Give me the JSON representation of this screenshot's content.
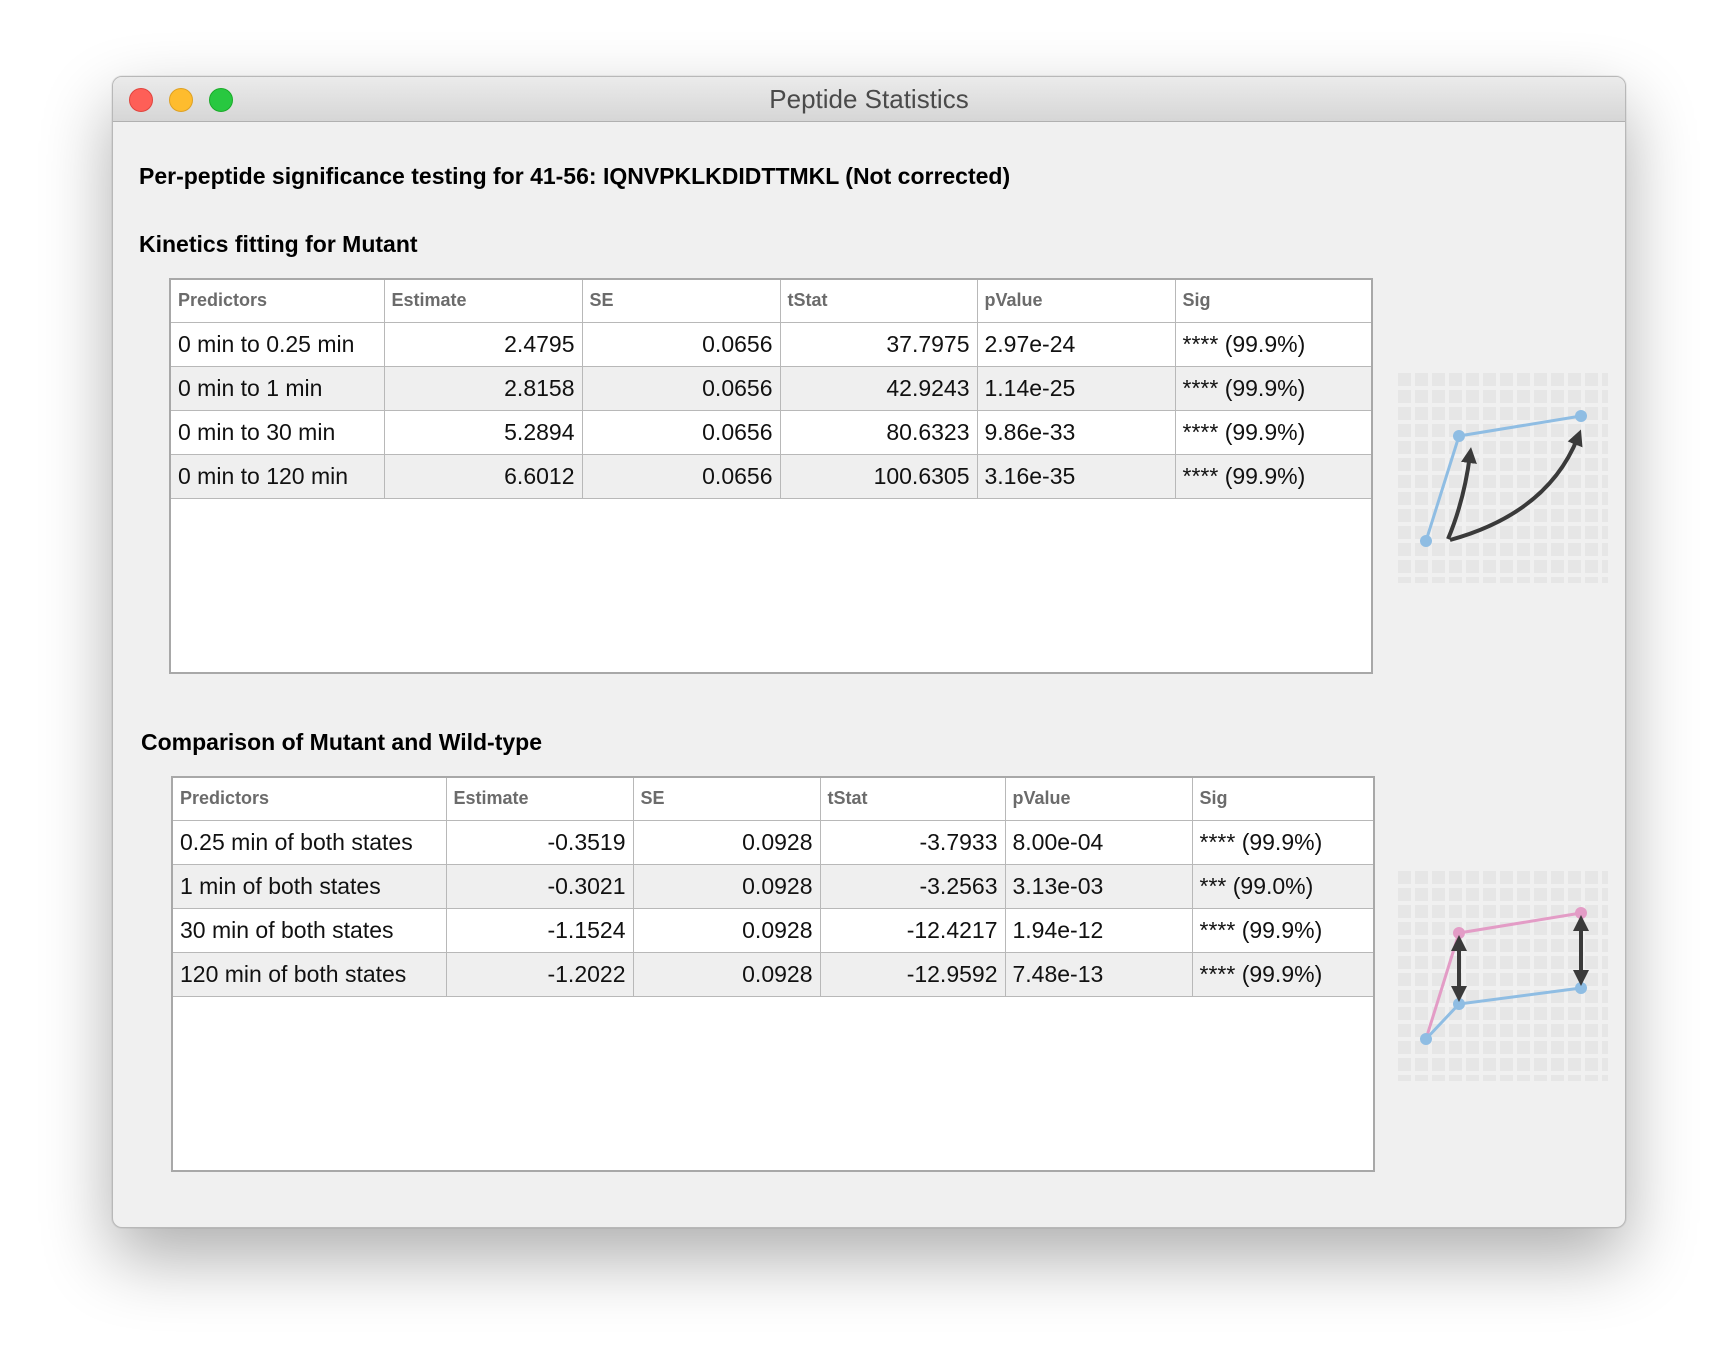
{
  "window": {
    "title": "Peptide Statistics"
  },
  "page_heading": "Per-peptide significance testing for 41-56: IQNVPKLKDIDTTMKL (Not corrected)",
  "kinetics": {
    "heading": "Kinetics fitting for Mutant",
    "columns": [
      "Predictors",
      "Estimate",
      "SE",
      "tStat",
      "pValue",
      "Sig"
    ],
    "rows": [
      [
        "0 min to 0.25 min",
        "2.4795",
        "0.0656",
        "37.7975",
        "2.97e-24",
        "**** (99.9%)"
      ],
      [
        "0 min to 1 min",
        "2.8158",
        "0.0656",
        "42.9243",
        "1.14e-25",
        "**** (99.9%)"
      ],
      [
        "0 min to 30 min",
        "5.2894",
        "0.0656",
        "80.6323",
        "9.86e-33",
        "**** (99.9%)"
      ],
      [
        "0 min to 120 min",
        "6.6012",
        "0.0656",
        "100.6305",
        "3.16e-35",
        "**** (99.9%)"
      ]
    ]
  },
  "comparison": {
    "heading": "Comparison of Mutant and Wild-type",
    "columns": [
      "Predictors",
      "Estimate",
      "SE",
      "tStat",
      "pValue",
      "Sig"
    ],
    "rows": [
      [
        "0.25 min of both states",
        "-0.3519",
        "0.0928",
        "-3.7933",
        "8.00e-04",
        "**** (99.9%)"
      ],
      [
        "1 min of both states",
        "-0.3021",
        "0.0928",
        "-3.2563",
        "3.13e-03",
        "*** (99.0%)"
      ],
      [
        "30 min of both states",
        "-1.1524",
        "0.0928",
        "-12.4217",
        "1.94e-12",
        "**** (99.9%)"
      ],
      [
        "120 min of both states",
        "-1.2022",
        "0.0928",
        "-12.9592",
        "7.48e-13",
        "**** (99.9%)"
      ]
    ]
  },
  "colors": {
    "mutant_line": "#8fbde3",
    "wildtype_line": "#e39cc6",
    "arrow": "#3a3a3a",
    "grid": "#e4e4e4"
  },
  "icons": {
    "kinetics_illustration": "kinetics-fit-illustration-icon",
    "comparison_illustration": "state-comparison-illustration-icon"
  }
}
